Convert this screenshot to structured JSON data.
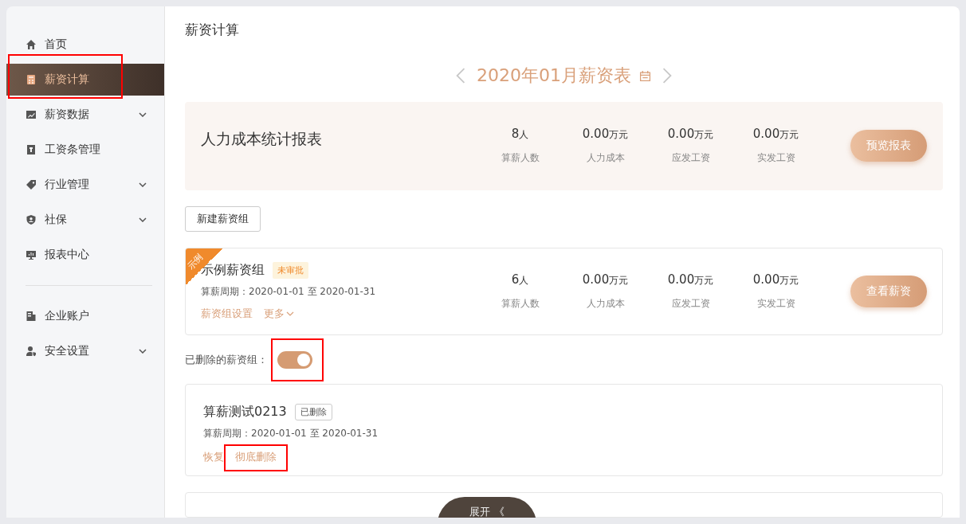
{
  "sidebar": {
    "main_items": [
      {
        "label": "首页",
        "selected": false,
        "has_submenu": false,
        "highlighted": false
      },
      {
        "label": "薪资计算",
        "selected": true,
        "has_submenu": false,
        "highlighted": true
      },
      {
        "label": "薪资数据",
        "selected": false,
        "has_submenu": true,
        "highlighted": false
      },
      {
        "label": "工资条管理",
        "selected": false,
        "has_submenu": false,
        "highlighted": false
      },
      {
        "label": "行业管理",
        "selected": false,
        "has_submenu": true,
        "highlighted": false
      },
      {
        "label": "社保",
        "selected": false,
        "has_submenu": true,
        "highlighted": false
      },
      {
        "label": "报表中心",
        "selected": false,
        "has_submenu": false,
        "highlighted": false
      }
    ],
    "account_items": [
      {
        "label": "企业账户",
        "selected": false,
        "has_submenu": false,
        "highlighted": false
      },
      {
        "label": "安全设置",
        "selected": false,
        "has_submenu": true,
        "highlighted": false
      }
    ]
  },
  "page_title": "薪资计算",
  "period_nav": {
    "title": "2020年01月薪资表"
  },
  "summary_card": {
    "title": "人力成本统计报表",
    "stats": [
      {
        "value": "8",
        "unit": "人",
        "label": "算薪人数"
      },
      {
        "value": "0.00",
        "unit": "万元",
        "label": "人力成本"
      },
      {
        "value": "0.00",
        "unit": "万元",
        "label": "应发工资"
      },
      {
        "value": "0.00",
        "unit": "万元",
        "label": "实发工资"
      }
    ],
    "button": "预览报表"
  },
  "new_group_button": "新建薪资组",
  "salary_groups": [
    {
      "ribbon": "示例",
      "name": "示例薪资组",
      "status": "未审批",
      "period": "算薪周期：2020-01-01 至 2020-01-31",
      "links": [
        {
          "label": "薪资组设置",
          "dropdown": false
        },
        {
          "label": "更多",
          "dropdown": true
        }
      ],
      "stats": [
        {
          "value": "6",
          "unit": "人",
          "label": "算薪人数"
        },
        {
          "value": "0.00",
          "unit": "万元",
          "label": "人力成本"
        },
        {
          "value": "0.00",
          "unit": "万元",
          "label": "应发工资"
        },
        {
          "value": "0.00",
          "unit": "万元",
          "label": "实发工资"
        }
      ],
      "button": "查看薪资"
    }
  ],
  "deleted_toggle": {
    "label": "已删除的薪资组：",
    "on": true,
    "highlighted": true
  },
  "deleted_groups": [
    {
      "name": "算薪测试0213",
      "status": "已删除",
      "period": "算薪周期：2020-01-01 至 2020-01-31",
      "links": [
        {
          "label": "恢复",
          "highlighted": false
        },
        {
          "label": "彻底删除",
          "highlighted": true
        }
      ]
    }
  ],
  "expand_tab": {
    "label": "展开 《"
  }
}
